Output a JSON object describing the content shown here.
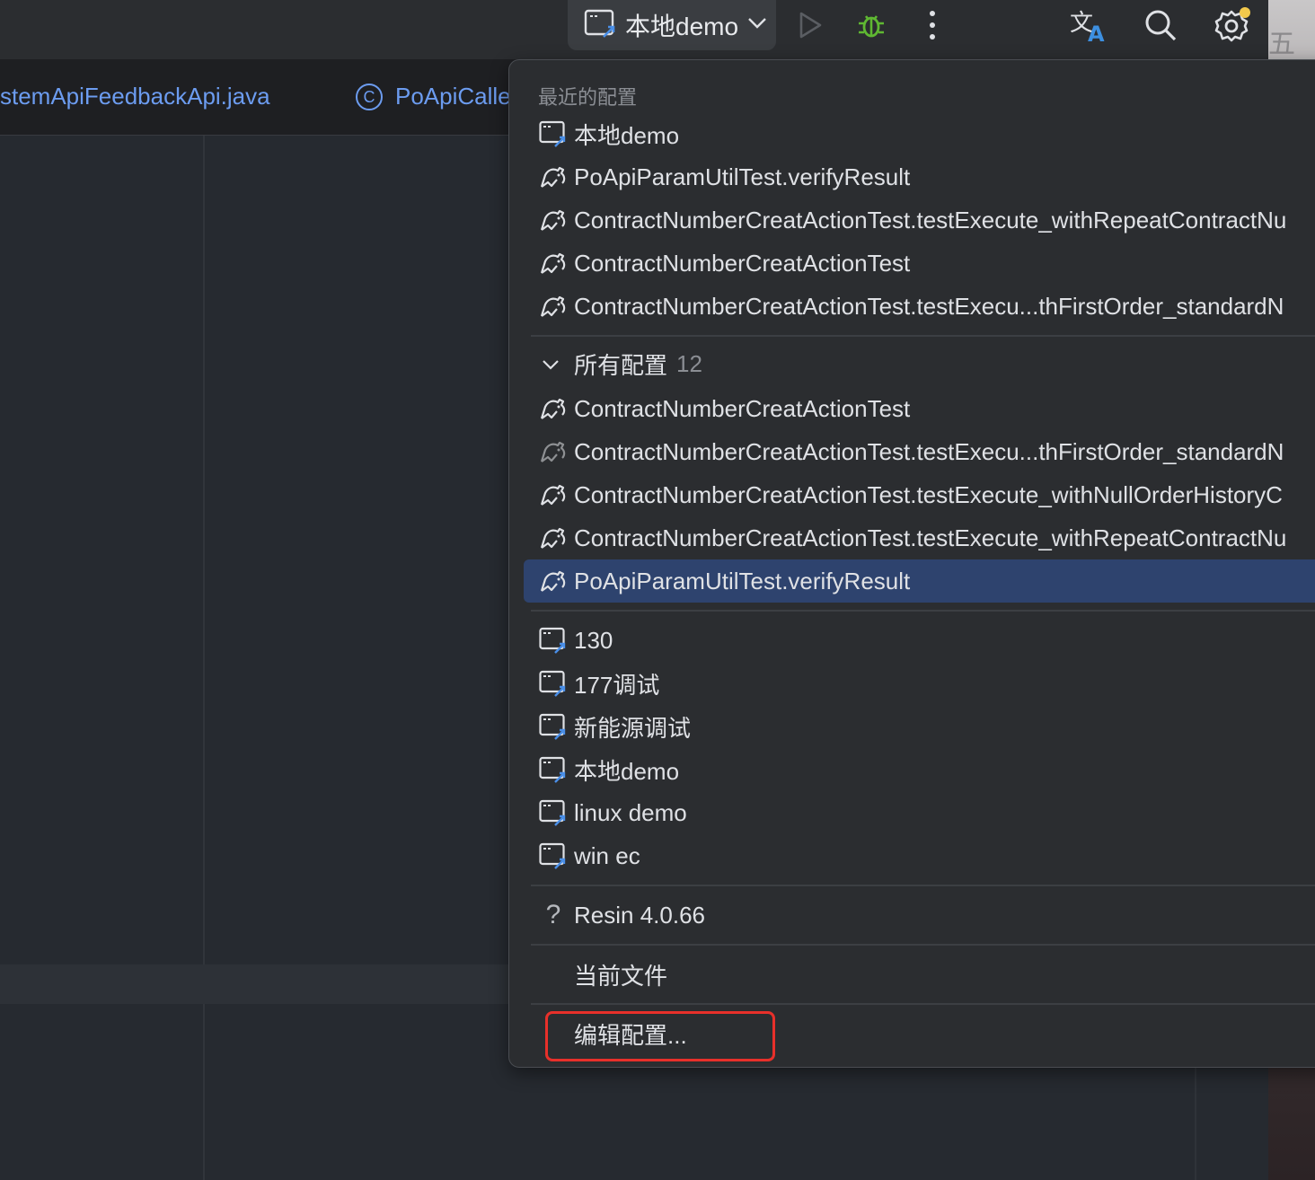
{
  "toolbar": {
    "run_config_label": "本地demo",
    "icons": [
      "run-config-icon",
      "chevron-down-icon",
      "run-icon",
      "debug-icon",
      "more-icon",
      "translate-icon",
      "search-icon",
      "settings-icon"
    ],
    "colors": {
      "debug": "#5fb832",
      "notification_dot": "#f2c94c",
      "translate_accent": "#3d8fe0"
    }
  },
  "edge": {
    "glyph": "五"
  },
  "tabs": [
    {
      "label": "stemApiFeedbackApi.java"
    },
    {
      "label": "PoApiCalle",
      "icon": "C"
    }
  ],
  "popup": {
    "recent_title": "最近的配置",
    "recent": [
      {
        "label": "本地demo",
        "icon": "remote-config-icon"
      },
      {
        "label": "PoApiParamUtilTest.verifyResult",
        "icon": "junit-icon"
      },
      {
        "label": "ContractNumberCreatActionTest.testExecute_withRepeatContractNu",
        "icon": "junit-icon"
      },
      {
        "label": "ContractNumberCreatActionTest",
        "icon": "junit-icon"
      },
      {
        "label": "ContractNumberCreatActionTest.testExecu...thFirstOrder_standardN",
        "icon": "junit-icon"
      }
    ],
    "all_title": "所有配置",
    "all_count": "12",
    "all": [
      {
        "label": "ContractNumberCreatActionTest",
        "icon": "junit-icon"
      },
      {
        "label": "ContractNumberCreatActionTest.testExecu...thFirstOrder_standardN",
        "icon": "junit-icon"
      },
      {
        "label": "ContractNumberCreatActionTest.testExecute_withNullOrderHistoryC",
        "icon": "junit-icon"
      },
      {
        "label": "ContractNumberCreatActionTest.testExecute_withRepeatContractNu",
        "icon": "junit-icon"
      },
      {
        "label": "PoApiParamUtilTest.verifyResult",
        "icon": "junit-icon",
        "selected": true
      }
    ],
    "remote": [
      {
        "label": "130"
      },
      {
        "label": "177调试"
      },
      {
        "label": "新能源调试"
      },
      {
        "label": "本地demo"
      },
      {
        "label": "linux demo"
      },
      {
        "label": "win ec"
      }
    ],
    "resin": {
      "label": "Resin 4.0.66",
      "icon": "question-icon"
    },
    "current_file": "当前文件",
    "edit_config": "编辑配置...",
    "colors": {
      "selected_bg": "#2e436e",
      "highlight_box": "#e8302a"
    }
  }
}
